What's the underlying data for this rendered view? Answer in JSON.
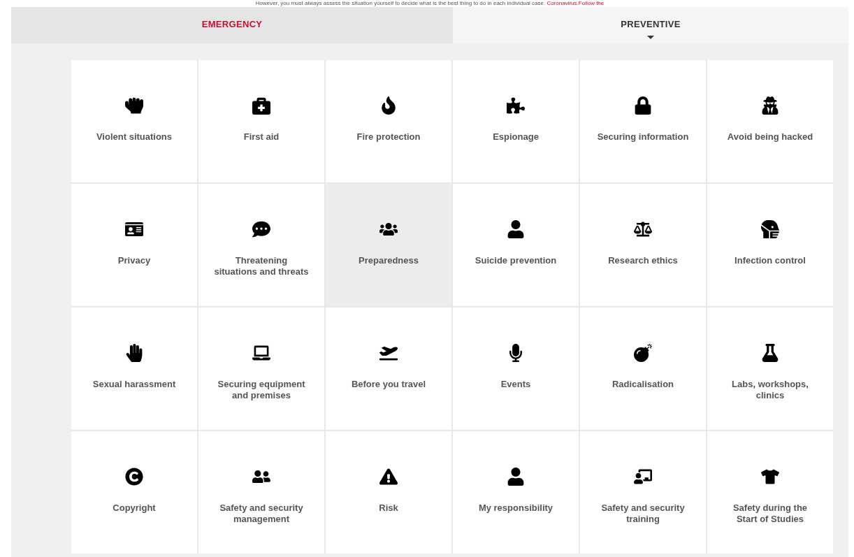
{
  "notice": {
    "text": "However, you must always assess the situation yourself to decide what is the best thing to do in each individual case.",
    "link": "Coronavirus.Follow the"
  },
  "tabs": [
    {
      "label": "EMERGENCY",
      "selected": true
    },
    {
      "label": "PREVENTIVE",
      "selected": false
    }
  ],
  "tiles": [
    {
      "label": "Violent situations",
      "highlighted": false
    },
    {
      "label": "First aid",
      "highlighted": false
    },
    {
      "label": "Fire protection",
      "highlighted": false
    },
    {
      "label": "Espionage",
      "highlighted": false
    },
    {
      "label": "Securing information",
      "highlighted": false
    },
    {
      "label": "Avoid being hacked",
      "highlighted": false
    },
    {
      "label": "Privacy",
      "highlighted": false
    },
    {
      "label": "Threatening situations and threats",
      "highlighted": false
    },
    {
      "label": "Preparedness",
      "highlighted": true
    },
    {
      "label": "Suicide prevention",
      "highlighted": false
    },
    {
      "label": "Research ethics",
      "highlighted": false
    },
    {
      "label": "Infection control",
      "highlighted": false
    },
    {
      "label": "Sexual harassment",
      "highlighted": false
    },
    {
      "label": "Securing equipment and premises",
      "highlighted": false
    },
    {
      "label": "Before you travel",
      "highlighted": false
    },
    {
      "label": "Events",
      "highlighted": false
    },
    {
      "label": "Radicalisation",
      "highlighted": false
    },
    {
      "label": "Labs, workshops, clinics",
      "highlighted": false
    },
    {
      "label": "Copyright",
      "highlighted": false
    },
    {
      "label": "Safety and security management",
      "highlighted": false
    },
    {
      "label": "Risk",
      "highlighted": false
    },
    {
      "label": "My responsibility",
      "highlighted": false
    },
    {
      "label": "Safety and security training",
      "highlighted": false
    },
    {
      "label": "Safety during the Start of Studies",
      "highlighted": false
    }
  ]
}
